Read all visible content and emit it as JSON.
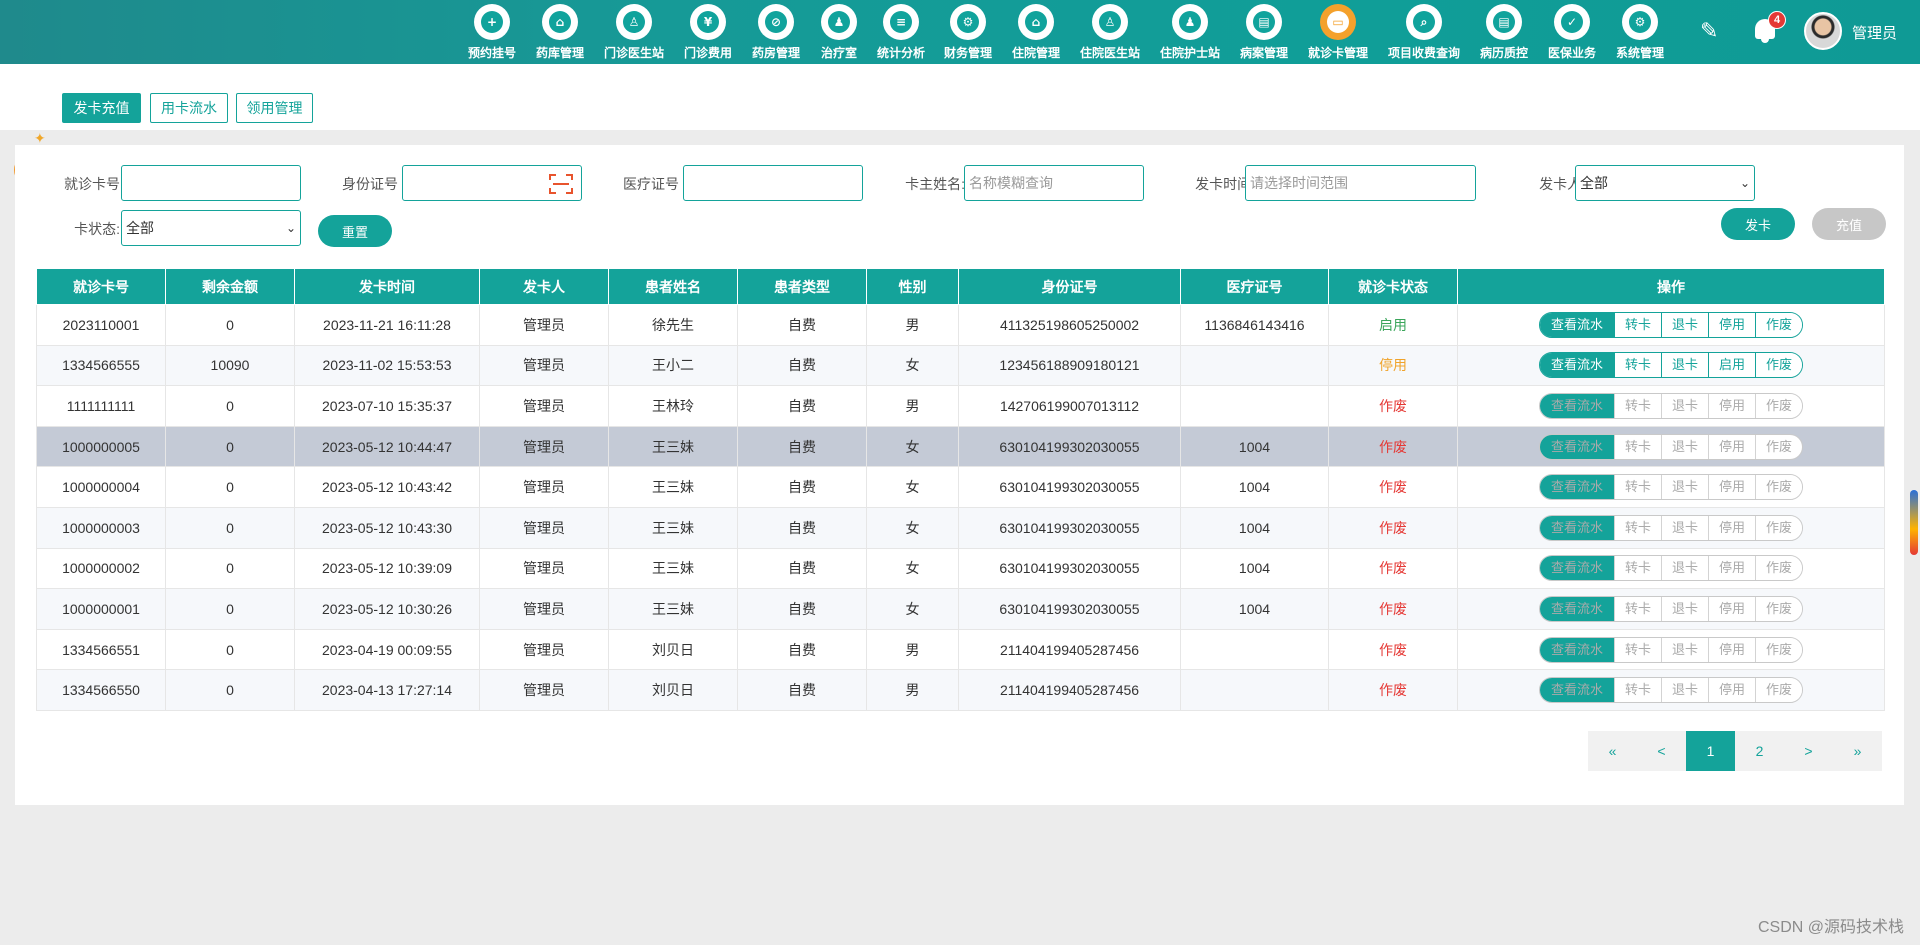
{
  "nav": {
    "items": [
      {
        "label": "预约挂号",
        "glyph": "+"
      },
      {
        "label": "药库管理",
        "glyph": "⌂"
      },
      {
        "label": "门诊医生站",
        "glyph": "♙"
      },
      {
        "label": "门诊费用",
        "glyph": "¥"
      },
      {
        "label": "药房管理",
        "glyph": "⊘"
      },
      {
        "label": "治疗室",
        "glyph": "♟"
      },
      {
        "label": "统计分析",
        "glyph": "≡"
      },
      {
        "label": "财务管理",
        "glyph": "⚙"
      },
      {
        "label": "住院管理",
        "glyph": "⌂"
      },
      {
        "label": "住院医生站",
        "glyph": "♙"
      },
      {
        "label": "住院护士站",
        "glyph": "♟"
      },
      {
        "label": "病案管理",
        "glyph": "▤"
      },
      {
        "label": "就诊卡管理",
        "glyph": "▭"
      },
      {
        "label": "项目收费查询",
        "glyph": "⌕"
      },
      {
        "label": "病历质控",
        "glyph": "▤"
      },
      {
        "label": "医保业务",
        "glyph": "✓"
      },
      {
        "label": "系统管理",
        "glyph": "⚙"
      }
    ],
    "active_index": 12,
    "notification_count": "4",
    "username": "管理员"
  },
  "tabs": [
    "发卡充值",
    "用卡流水",
    "领用管理"
  ],
  "filters": {
    "card_no_label": "就诊卡号",
    "id_no_label": "身份证号",
    "med_no_label": "医疗证号",
    "holder_label": "卡主姓名:",
    "holder_placeholder": "名称模糊查询",
    "issue_time_label": "发卡时间:",
    "issue_time_placeholder": "请选择时间范围",
    "issuer_label": "发卡人:",
    "issuer_value": "全部",
    "status_label": "卡状态:",
    "status_value": "全部",
    "reset_label": "重置",
    "issue_label": "发卡",
    "recharge_label": "充值"
  },
  "table": {
    "headers": [
      "就诊卡号",
      "剩余金额",
      "发卡时间",
      "发卡人",
      "患者姓名",
      "患者类型",
      "性别",
      "身份证号",
      "医疗证号",
      "就诊卡状态",
      "操作"
    ],
    "ops": [
      "查看流水",
      "转卡",
      "退卡",
      "作废"
    ],
    "rows": [
      {
        "card": "2023110001",
        "balance": "0",
        "time": "2023-11-21 16:11:28",
        "issuer": "管理员",
        "name": "徐先生",
        "type": "自费",
        "gender": "男",
        "id": "411325198605250002",
        "med": "1136846143416",
        "status": "启用",
        "toggle": "停用"
      },
      {
        "card": "1334566555",
        "balance": "10090",
        "time": "2023-11-02 15:53:53",
        "issuer": "管理员",
        "name": "王小二",
        "type": "自费",
        "gender": "女",
        "id": "123456188909180121",
        "med": "",
        "status": "停用",
        "toggle": "启用"
      },
      {
        "card": "1111111111",
        "balance": "0",
        "time": "2023-07-10 15:35:37",
        "issuer": "管理员",
        "name": "王林玲",
        "type": "自费",
        "gender": "男",
        "id": "142706199007013112",
        "med": "",
        "status": "作废",
        "toggle": "停用"
      },
      {
        "card": "1000000005",
        "balance": "0",
        "time": "2023-05-12 10:44:47",
        "issuer": "管理员",
        "name": "王三妹",
        "type": "自费",
        "gender": "女",
        "id": "630104199302030055",
        "med": "1004",
        "status": "作废",
        "toggle": "停用"
      },
      {
        "card": "1000000004",
        "balance": "0",
        "time": "2023-05-12 10:43:42",
        "issuer": "管理员",
        "name": "王三妹",
        "type": "自费",
        "gender": "女",
        "id": "630104199302030055",
        "med": "1004",
        "status": "作废",
        "toggle": "停用"
      },
      {
        "card": "1000000003",
        "balance": "0",
        "time": "2023-05-12 10:43:30",
        "issuer": "管理员",
        "name": "王三妹",
        "type": "自费",
        "gender": "女",
        "id": "630104199302030055",
        "med": "1004",
        "status": "作废",
        "toggle": "停用"
      },
      {
        "card": "1000000002",
        "balance": "0",
        "time": "2023-05-12 10:39:09",
        "issuer": "管理员",
        "name": "王三妹",
        "type": "自费",
        "gender": "女",
        "id": "630104199302030055",
        "med": "1004",
        "status": "作废",
        "toggle": "停用"
      },
      {
        "card": "1000000001",
        "balance": "0",
        "time": "2023-05-12 10:30:26",
        "issuer": "管理员",
        "name": "王三妹",
        "type": "自费",
        "gender": "女",
        "id": "630104199302030055",
        "med": "1004",
        "status": "作废",
        "toggle": "停用"
      },
      {
        "card": "1334566551",
        "balance": "0",
        "time": "2023-04-19 00:09:55",
        "issuer": "管理员",
        "name": "刘贝日",
        "type": "自费",
        "gender": "男",
        "id": "211404199405287456",
        "med": "",
        "status": "作废",
        "toggle": "停用"
      },
      {
        "card": "1334566550",
        "balance": "0",
        "time": "2023-04-13 17:27:14",
        "issuer": "管理员",
        "name": "刘贝日",
        "type": "自费",
        "gender": "男",
        "id": "211404199405287456",
        "med": "",
        "status": "作废",
        "toggle": "停用"
      }
    ],
    "selected_row": 3
  },
  "pager": {
    "first": "«",
    "prev": "<",
    "pages": [
      "1",
      "2"
    ],
    "current": "1",
    "next": ">",
    "last": "»"
  },
  "watermark": "CSDN @源码技术栈",
  "colors": {
    "primary": "#14a39a",
    "active_nav": "#f4a12c",
    "status_enabled": "#3aa55a",
    "status_stopped": "#f0a32a",
    "status_void": "#e53935"
  }
}
